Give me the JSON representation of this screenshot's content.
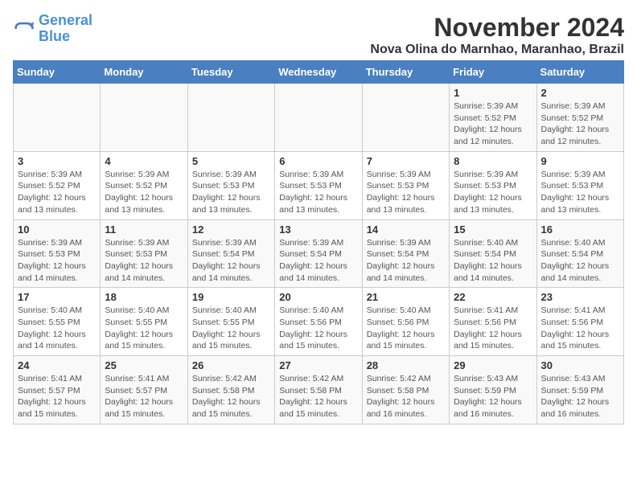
{
  "logo": {
    "line1": "General",
    "line2": "Blue"
  },
  "title": "November 2024",
  "subtitle": "Nova Olina do Marnhao, Maranhao, Brazil",
  "weekdays": [
    "Sunday",
    "Monday",
    "Tuesday",
    "Wednesday",
    "Thursday",
    "Friday",
    "Saturday"
  ],
  "weeks": [
    [
      {
        "day": "",
        "detail": ""
      },
      {
        "day": "",
        "detail": ""
      },
      {
        "day": "",
        "detail": ""
      },
      {
        "day": "",
        "detail": ""
      },
      {
        "day": "",
        "detail": ""
      },
      {
        "day": "1",
        "detail": "Sunrise: 5:39 AM\nSunset: 5:52 PM\nDaylight: 12 hours\nand 12 minutes."
      },
      {
        "day": "2",
        "detail": "Sunrise: 5:39 AM\nSunset: 5:52 PM\nDaylight: 12 hours\nand 12 minutes."
      }
    ],
    [
      {
        "day": "3",
        "detail": "Sunrise: 5:39 AM\nSunset: 5:52 PM\nDaylight: 12 hours\nand 13 minutes."
      },
      {
        "day": "4",
        "detail": "Sunrise: 5:39 AM\nSunset: 5:52 PM\nDaylight: 12 hours\nand 13 minutes."
      },
      {
        "day": "5",
        "detail": "Sunrise: 5:39 AM\nSunset: 5:53 PM\nDaylight: 12 hours\nand 13 minutes."
      },
      {
        "day": "6",
        "detail": "Sunrise: 5:39 AM\nSunset: 5:53 PM\nDaylight: 12 hours\nand 13 minutes."
      },
      {
        "day": "7",
        "detail": "Sunrise: 5:39 AM\nSunset: 5:53 PM\nDaylight: 12 hours\nand 13 minutes."
      },
      {
        "day": "8",
        "detail": "Sunrise: 5:39 AM\nSunset: 5:53 PM\nDaylight: 12 hours\nand 13 minutes."
      },
      {
        "day": "9",
        "detail": "Sunrise: 5:39 AM\nSunset: 5:53 PM\nDaylight: 12 hours\nand 13 minutes."
      }
    ],
    [
      {
        "day": "10",
        "detail": "Sunrise: 5:39 AM\nSunset: 5:53 PM\nDaylight: 12 hours\nand 14 minutes."
      },
      {
        "day": "11",
        "detail": "Sunrise: 5:39 AM\nSunset: 5:53 PM\nDaylight: 12 hours\nand 14 minutes."
      },
      {
        "day": "12",
        "detail": "Sunrise: 5:39 AM\nSunset: 5:54 PM\nDaylight: 12 hours\nand 14 minutes."
      },
      {
        "day": "13",
        "detail": "Sunrise: 5:39 AM\nSunset: 5:54 PM\nDaylight: 12 hours\nand 14 minutes."
      },
      {
        "day": "14",
        "detail": "Sunrise: 5:39 AM\nSunset: 5:54 PM\nDaylight: 12 hours\nand 14 minutes."
      },
      {
        "day": "15",
        "detail": "Sunrise: 5:40 AM\nSunset: 5:54 PM\nDaylight: 12 hours\nand 14 minutes."
      },
      {
        "day": "16",
        "detail": "Sunrise: 5:40 AM\nSunset: 5:54 PM\nDaylight: 12 hours\nand 14 minutes."
      }
    ],
    [
      {
        "day": "17",
        "detail": "Sunrise: 5:40 AM\nSunset: 5:55 PM\nDaylight: 12 hours\nand 14 minutes."
      },
      {
        "day": "18",
        "detail": "Sunrise: 5:40 AM\nSunset: 5:55 PM\nDaylight: 12 hours\nand 15 minutes."
      },
      {
        "day": "19",
        "detail": "Sunrise: 5:40 AM\nSunset: 5:55 PM\nDaylight: 12 hours\nand 15 minutes."
      },
      {
        "day": "20",
        "detail": "Sunrise: 5:40 AM\nSunset: 5:56 PM\nDaylight: 12 hours\nand 15 minutes."
      },
      {
        "day": "21",
        "detail": "Sunrise: 5:40 AM\nSunset: 5:56 PM\nDaylight: 12 hours\nand 15 minutes."
      },
      {
        "day": "22",
        "detail": "Sunrise: 5:41 AM\nSunset: 5:56 PM\nDaylight: 12 hours\nand 15 minutes."
      },
      {
        "day": "23",
        "detail": "Sunrise: 5:41 AM\nSunset: 5:56 PM\nDaylight: 12 hours\nand 15 minutes."
      }
    ],
    [
      {
        "day": "24",
        "detail": "Sunrise: 5:41 AM\nSunset: 5:57 PM\nDaylight: 12 hours\nand 15 minutes."
      },
      {
        "day": "25",
        "detail": "Sunrise: 5:41 AM\nSunset: 5:57 PM\nDaylight: 12 hours\nand 15 minutes."
      },
      {
        "day": "26",
        "detail": "Sunrise: 5:42 AM\nSunset: 5:58 PM\nDaylight: 12 hours\nand 15 minutes."
      },
      {
        "day": "27",
        "detail": "Sunrise: 5:42 AM\nSunset: 5:58 PM\nDaylight: 12 hours\nand 15 minutes."
      },
      {
        "day": "28",
        "detail": "Sunrise: 5:42 AM\nSunset: 5:58 PM\nDaylight: 12 hours\nand 16 minutes."
      },
      {
        "day": "29",
        "detail": "Sunrise: 5:43 AM\nSunset: 5:59 PM\nDaylight: 12 hours\nand 16 minutes."
      },
      {
        "day": "30",
        "detail": "Sunrise: 5:43 AM\nSunset: 5:59 PM\nDaylight: 12 hours\nand 16 minutes."
      }
    ]
  ]
}
